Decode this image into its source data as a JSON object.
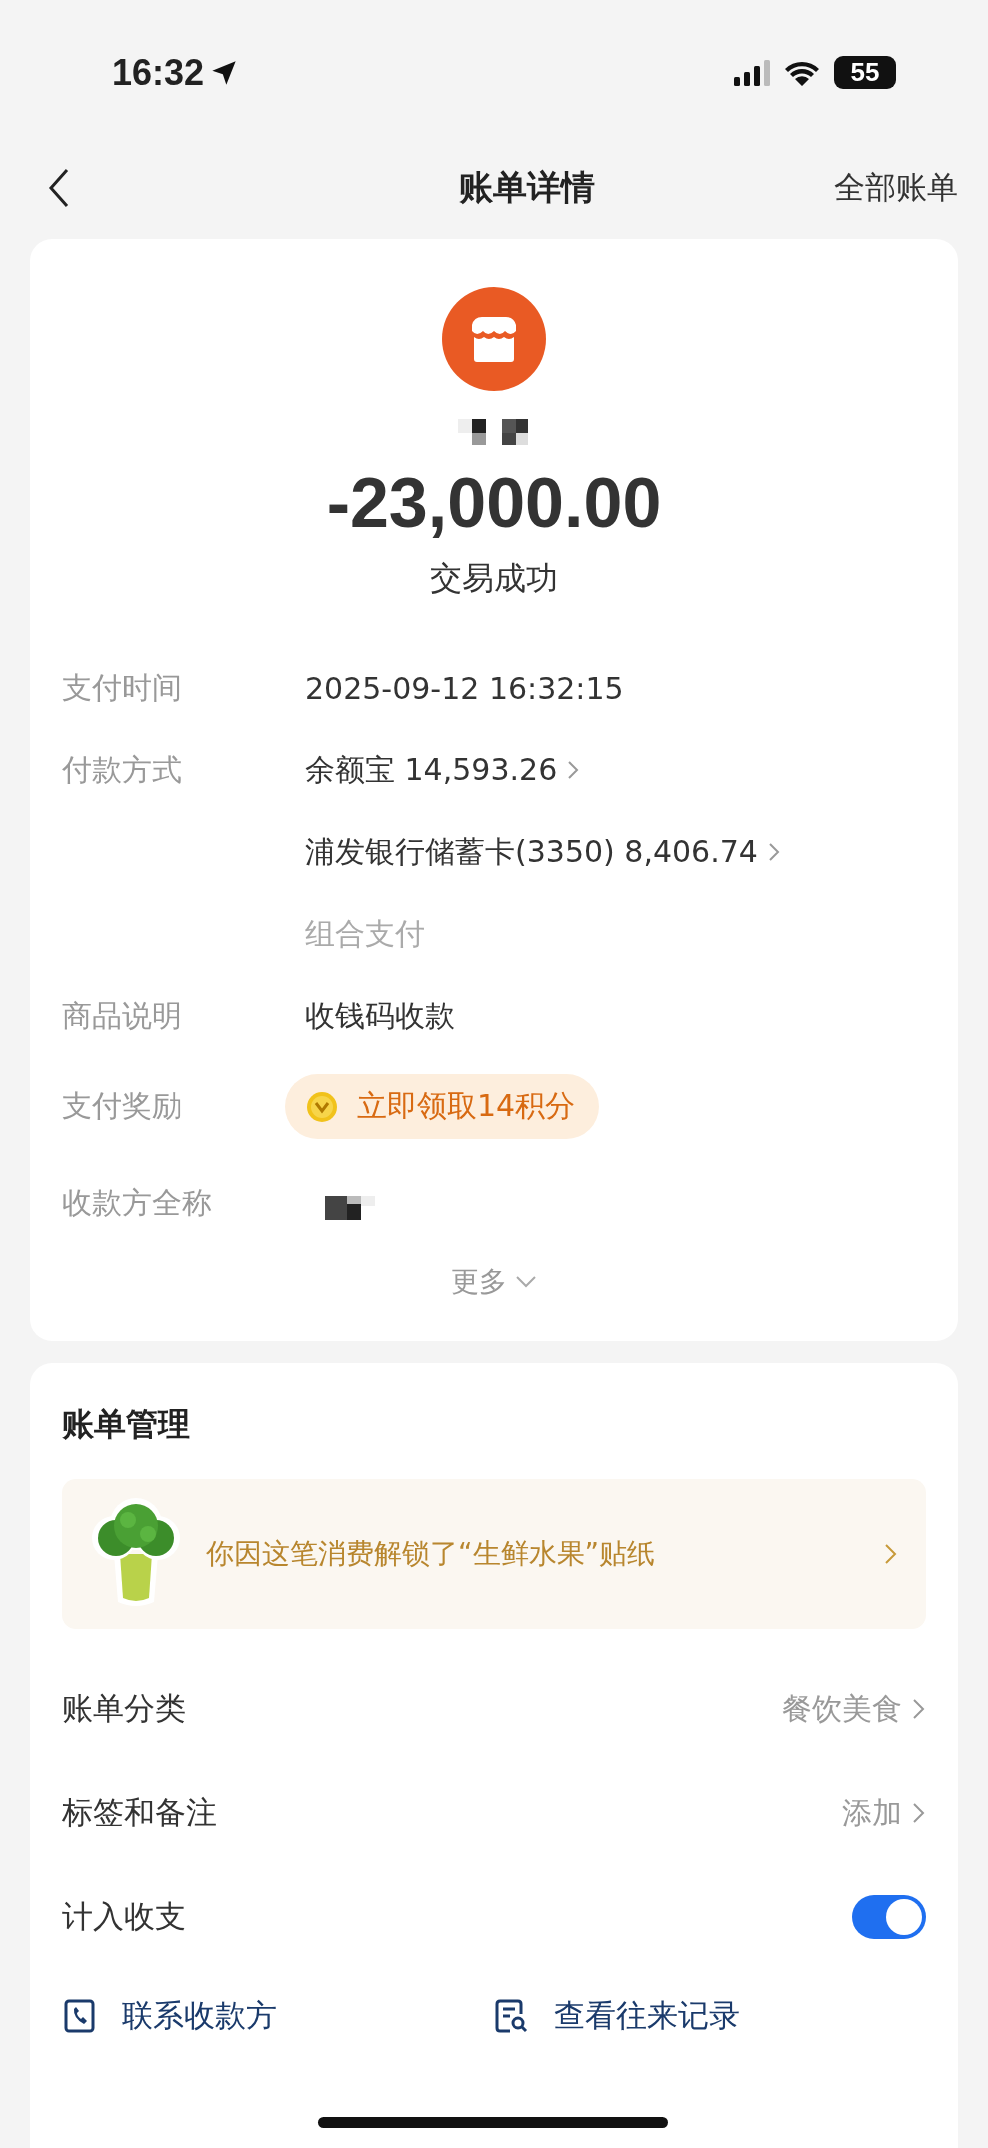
{
  "status_bar": {
    "time": "16:32",
    "battery": "55"
  },
  "nav": {
    "title": "账单详情",
    "right_link": "全部账单"
  },
  "summary": {
    "amount": "-23,000.00",
    "status": "交易成功"
  },
  "details": [
    {
      "kind": "text",
      "label": "支付时间",
      "value": "2025-09-12 16:32:15"
    },
    {
      "kind": "link",
      "label": "付款方式",
      "value": "余额宝 14,593.26"
    },
    {
      "kind": "link",
      "value": "浦发银行储蓄卡(3350) 8,406.74"
    },
    {
      "kind": "note",
      "value": "组合支付"
    },
    {
      "kind": "text",
      "label": "商品说明",
      "value": "收钱码收款"
    },
    {
      "kind": "reward",
      "label": "支付奖励",
      "value": "立即领取14积分"
    },
    {
      "kind": "hidden",
      "label": "收款方全称"
    }
  ],
  "more": "更多",
  "management": {
    "title": "账单管理",
    "banner": "你因这笔消费解锁了“生鲜水果”贴纸",
    "rows": [
      {
        "kind": "link",
        "label": "账单分类",
        "value": "餐饮美食"
      },
      {
        "kind": "link",
        "label": "标签和备注",
        "value": "添加"
      },
      {
        "kind": "toggle",
        "label": "计入收支",
        "on": true
      }
    ],
    "actions": [
      {
        "kind": "phone",
        "label": "联系收款方"
      },
      {
        "kind": "record",
        "label": "查看往来记录"
      }
    ]
  }
}
